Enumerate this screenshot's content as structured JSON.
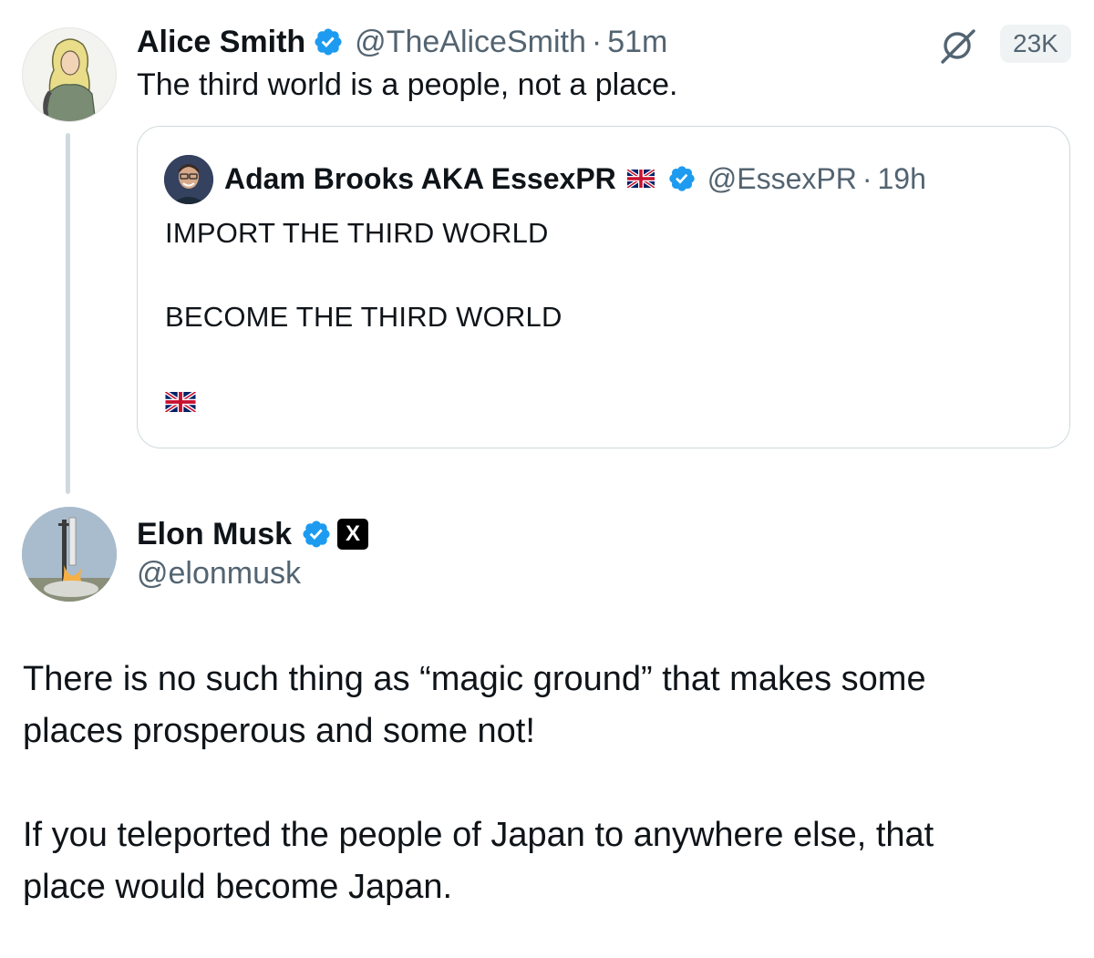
{
  "reply_tweet": {
    "author_name": "Alice Smith",
    "handle": "@TheAliceSmith",
    "separator": "·",
    "time": "51m",
    "text": "The third world is a people, not a place.",
    "views_badge": "23K",
    "grok_icon": "grok-icon"
  },
  "quoted_tweet": {
    "author_name": "Adam Brooks AKA EssexPR",
    "handle": "@EssexPR",
    "separator": "·",
    "time": "19h",
    "lines": [
      "IMPORT THE THIRD WORLD",
      "BECOME THE THIRD WORLD"
    ],
    "flag_icon": "uk-flag-icon"
  },
  "main_tweet": {
    "author_name": "Elon Musk",
    "handle": "@elonmusk",
    "affiliate_badge": "X",
    "paragraph_1": [
      "There is no such thing as “magic ground” that makes some",
      "places prosperous and some not!"
    ],
    "paragraph_2": [
      "If you teleported the people of Japan to anywhere else, that",
      "place would become Japan."
    ]
  },
  "colors": {
    "verified_blue": "#1d9bf0",
    "text_primary": "#0f1419",
    "text_secondary": "#536471",
    "border": "#cfd9de"
  }
}
